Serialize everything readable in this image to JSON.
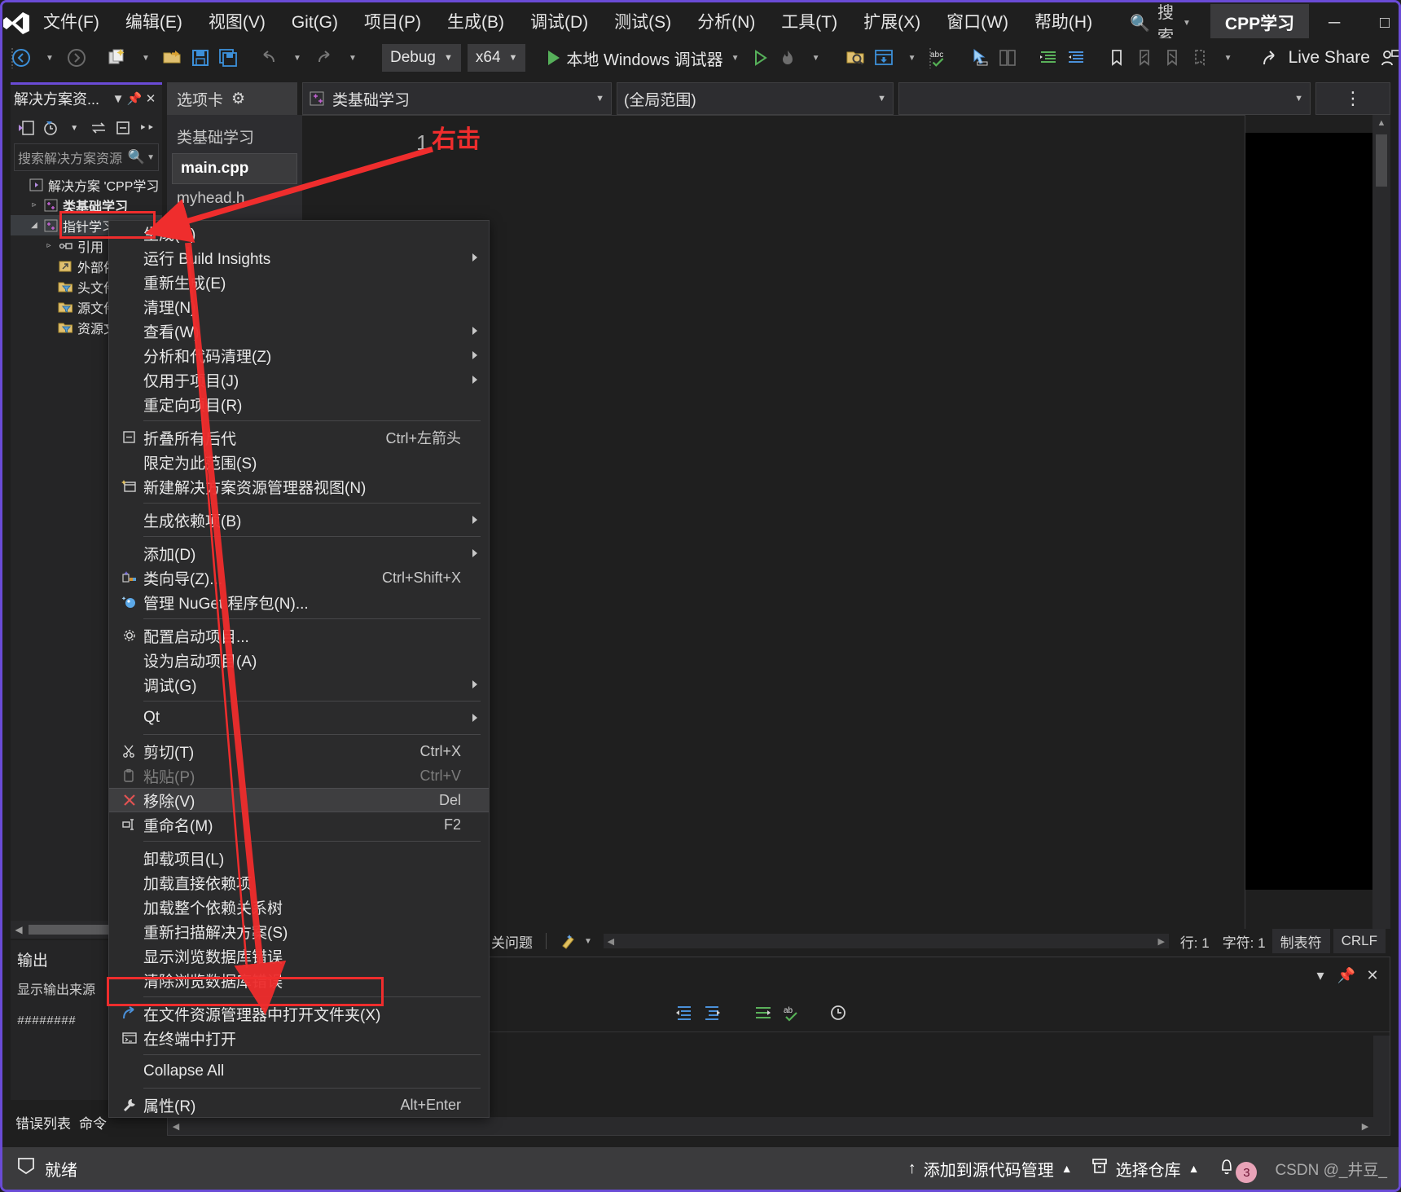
{
  "titlebar": {
    "logo_icon": "visual-studio-logo",
    "menus": [
      {
        "label": "文件(F)"
      },
      {
        "label": "编辑(E)"
      },
      {
        "label": "视图(V)"
      },
      {
        "label": "Git(G)"
      },
      {
        "label": "项目(P)"
      },
      {
        "label": "生成(B)"
      },
      {
        "label": "调试(D)"
      },
      {
        "label": "测试(S)"
      },
      {
        "label": "分析(N)"
      },
      {
        "label": "工具(T)"
      },
      {
        "label": "扩展(X)"
      },
      {
        "label": "窗口(W)"
      },
      {
        "label": "帮助(H)"
      }
    ],
    "search_label": "搜索",
    "search_icon": "search-icon",
    "project_chip": "CPP学习",
    "minimize": "─",
    "maximize": "□",
    "close": "✕"
  },
  "toolbar": {
    "nav_back_icon": "arrow-left-circle-icon",
    "nav_forward_icon": "arrow-right-circle-icon",
    "new_item_icon": "new-project-icon",
    "open_icon": "open-folder-icon",
    "save_icon": "save-icon",
    "save_all_icon": "save-all-icon",
    "undo_icon": "undo-icon",
    "redo_icon": "redo-icon",
    "config_value": "Debug",
    "platform_value": "x64",
    "run_label": "本地 Windows 调试器",
    "run_icon": "play-icon",
    "start_no_debug_icon": "play-outline-icon",
    "hot_reload_icon": "hot-reload-icon",
    "search_folder_icon": "folder-search-icon",
    "window_layout_icon": "window-layout-icon",
    "spellcheck_icon": "abc-check-icon",
    "pointer_icon": "pointer-select-icon",
    "compare_icon": "compare-icon",
    "indent_icon": "indent-icon",
    "outdent_icon": "outdent-icon",
    "bookmark_icon": "bookmark-icon",
    "bookmark_prev_icon": "bookmark-prev-icon",
    "bookmark_next_icon": "bookmark-next-icon",
    "bookmark_clear_icon": "bookmark-clear-icon",
    "live_share_label": "Live Share",
    "live_share_icon": "share-icon",
    "live_share_user_icon": "person-share-icon"
  },
  "solution_explorer": {
    "title": "解决方案资...",
    "dropdown_icon": "chevron-down-icon",
    "pin_icon": "pin-icon",
    "close_icon": "close-icon",
    "toolbar_icons": [
      "home-view-icon",
      "pending-changes-icon",
      "chevron-down-icon",
      "sync-icon",
      "collapse-all-icon",
      "overflow-icon"
    ],
    "search_placeholder": "搜索解决方案资源",
    "search_icon": "magnifier-icon",
    "search_caret_icon": "chevron-down-icon",
    "tree": [
      {
        "label": "解决方案 'CPP学习",
        "icon": "solution-icon",
        "indent": 0,
        "twisty": "",
        "bold": false,
        "selected": false
      },
      {
        "label": "类基础学习",
        "icon": "cpp-project-icon",
        "indent": 1,
        "twisty": "▹",
        "bold": true,
        "selected": false
      },
      {
        "label": "指针学习",
        "icon": "cpp-project-icon",
        "indent": 1,
        "twisty": "◢",
        "bold": false,
        "selected": true
      },
      {
        "label": "引用",
        "icon": "references-icon",
        "indent": 2,
        "twisty": "▹",
        "bold": false,
        "selected": false
      },
      {
        "label": "外部依赖项",
        "icon": "external-deps-icon",
        "indent": 2,
        "twisty": "",
        "bold": false,
        "selected": false
      },
      {
        "label": "头文件",
        "icon": "filter-folder-icon",
        "indent": 2,
        "twisty": "",
        "bold": false,
        "selected": false
      },
      {
        "label": "源文件",
        "icon": "filter-folder-icon",
        "indent": 2,
        "twisty": "",
        "bold": false,
        "selected": false
      },
      {
        "label": "资源文件",
        "icon": "filter-folder-icon",
        "indent": 2,
        "twisty": "",
        "bold": false,
        "selected": false
      }
    ]
  },
  "editor": {
    "tabstrip_label": "选项卡",
    "tabstrip_gear_icon": "gear-icon",
    "file_combo_value": "类基础学习",
    "file_combo_icon": "cpp-project-icon",
    "scope_combo_value": "(全局范围)",
    "third_combo_value": "",
    "split_icon": "split-view-icon",
    "tab_group_label": "类基础学习",
    "tabs": [
      {
        "label": "main.cpp",
        "active": true
      },
      {
        "label": "myhead.h",
        "active": false
      }
    ],
    "line_number": "1"
  },
  "editor_status": {
    "issues_label": "关问题",
    "brush_icon": "formatting-icon",
    "line_label": "行: 1",
    "col_label": "字符: 1",
    "tab_label": "制表符",
    "eol_label": "CRLF"
  },
  "output_panel": {
    "title": "输出",
    "source_label": "显示输出来源",
    "content": "########"
  },
  "bottom_tabs": {
    "items": [
      "错误列表",
      "命令"
    ]
  },
  "lower_panel": {
    "toolbar_icons": [
      "outdent-icon",
      "indent-icon",
      "wrap-icon",
      "abc-check-icon",
      "history-icon"
    ],
    "collapse_icon": "collapse-icon",
    "pin_icon": "pin-icon",
    "close_icon": "close-icon"
  },
  "statusbar": {
    "ready_label": "就绪",
    "ready_icon": "flag-icon",
    "source_control_label": "添加到源代码管理",
    "source_control_icon": "arrow-up-icon",
    "source_control_caret": "▲",
    "repo_label": "选择仓库",
    "repo_icon": "repo-icon",
    "repo_caret": "▲",
    "notification_icon": "bell-icon",
    "notification_count": "3",
    "watermark": "CSDN @_井豆_"
  },
  "context_menu": {
    "items": [
      {
        "label": "生成(U)",
        "icon": "",
        "shortcut": "",
        "submenu": false,
        "divider_after": false,
        "disabled": false,
        "highlight": false
      },
      {
        "label": "运行 Build Insights",
        "icon": "",
        "shortcut": "",
        "submenu": true,
        "divider_after": false,
        "disabled": false,
        "highlight": false
      },
      {
        "label": "重新生成(E)",
        "icon": "",
        "shortcut": "",
        "submenu": false,
        "divider_after": false,
        "disabled": false,
        "highlight": false
      },
      {
        "label": "清理(N)",
        "icon": "",
        "shortcut": "",
        "submenu": false,
        "divider_after": false,
        "disabled": false,
        "highlight": false
      },
      {
        "label": "查看(W)",
        "icon": "",
        "shortcut": "",
        "submenu": true,
        "divider_after": false,
        "disabled": false,
        "highlight": false
      },
      {
        "label": "分析和代码清理(Z)",
        "icon": "",
        "shortcut": "",
        "submenu": true,
        "divider_after": false,
        "disabled": false,
        "highlight": false
      },
      {
        "label": "仅用于项目(J)",
        "icon": "",
        "shortcut": "",
        "submenu": true,
        "divider_after": false,
        "disabled": false,
        "highlight": false
      },
      {
        "label": "重定向项目(R)",
        "icon": "",
        "shortcut": "",
        "submenu": false,
        "divider_after": true,
        "disabled": false,
        "highlight": false
      },
      {
        "label": "折叠所有后代",
        "icon": "collapse-box-icon",
        "shortcut": "Ctrl+左箭头",
        "submenu": false,
        "divider_after": false,
        "disabled": false,
        "highlight": false
      },
      {
        "label": "限定为此范围(S)",
        "icon": "",
        "shortcut": "",
        "submenu": false,
        "divider_after": false,
        "disabled": false,
        "highlight": false
      },
      {
        "label": "新建解决方案资源管理器视图(N)",
        "icon": "new-view-icon",
        "shortcut": "",
        "submenu": false,
        "divider_after": true,
        "disabled": false,
        "highlight": false
      },
      {
        "label": "生成依赖项(B)",
        "icon": "",
        "shortcut": "",
        "submenu": true,
        "divider_after": true,
        "disabled": false,
        "highlight": false
      },
      {
        "label": "添加(D)",
        "icon": "",
        "shortcut": "",
        "submenu": true,
        "divider_after": false,
        "disabled": false,
        "highlight": false
      },
      {
        "label": "类向导(Z)...",
        "icon": "class-wizard-icon",
        "shortcut": "Ctrl+Shift+X",
        "submenu": false,
        "divider_after": false,
        "disabled": false,
        "highlight": false
      },
      {
        "label": "管理 NuGet 程序包(N)...",
        "icon": "nuget-icon",
        "shortcut": "",
        "submenu": false,
        "divider_after": true,
        "disabled": false,
        "highlight": false
      },
      {
        "label": "配置启动项目...",
        "icon": "gear-icon",
        "shortcut": "",
        "submenu": false,
        "divider_after": false,
        "disabled": false,
        "highlight": false
      },
      {
        "label": "设为启动项目(A)",
        "icon": "",
        "shortcut": "",
        "submenu": false,
        "divider_after": false,
        "disabled": false,
        "highlight": false
      },
      {
        "label": "调试(G)",
        "icon": "",
        "shortcut": "",
        "submenu": true,
        "divider_after": true,
        "disabled": false,
        "highlight": false
      },
      {
        "label": "Qt",
        "icon": "",
        "shortcut": "",
        "submenu": true,
        "divider_after": true,
        "disabled": false,
        "highlight": false
      },
      {
        "label": "剪切(T)",
        "icon": "scissors-icon",
        "shortcut": "Ctrl+X",
        "submenu": false,
        "divider_after": false,
        "disabled": false,
        "highlight": false
      },
      {
        "label": "粘贴(P)",
        "icon": "clipboard-icon",
        "shortcut": "Ctrl+V",
        "submenu": false,
        "divider_after": false,
        "disabled": true,
        "highlight": false
      },
      {
        "label": "移除(V)",
        "icon": "x-red-icon",
        "shortcut": "Del",
        "submenu": false,
        "divider_after": false,
        "disabled": false,
        "highlight": true
      },
      {
        "label": "重命名(M)",
        "icon": "rename-icon",
        "shortcut": "F2",
        "submenu": false,
        "divider_after": true,
        "disabled": false,
        "highlight": false
      },
      {
        "label": "卸载项目(L)",
        "icon": "",
        "shortcut": "",
        "submenu": false,
        "divider_after": false,
        "disabled": false,
        "highlight": false
      },
      {
        "label": "加载直接依赖项",
        "icon": "",
        "shortcut": "",
        "submenu": false,
        "divider_after": false,
        "disabled": false,
        "highlight": false
      },
      {
        "label": "加载整个依赖关系树",
        "icon": "",
        "shortcut": "",
        "submenu": false,
        "divider_after": false,
        "disabled": false,
        "highlight": false
      },
      {
        "label": "重新扫描解决方案(S)",
        "icon": "",
        "shortcut": "",
        "submenu": false,
        "divider_after": false,
        "disabled": false,
        "highlight": false
      },
      {
        "label": "显示浏览数据库错误",
        "icon": "",
        "shortcut": "",
        "submenu": false,
        "divider_after": false,
        "disabled": false,
        "highlight": false
      },
      {
        "label": "清除浏览数据库错误",
        "icon": "",
        "shortcut": "",
        "submenu": false,
        "divider_after": true,
        "disabled": false,
        "highlight": false
      },
      {
        "label": "在文件资源管理器中打开文件夹(X)",
        "icon": "open-folder-arrow-icon",
        "shortcut": "",
        "submenu": false,
        "divider_after": false,
        "disabled": false,
        "highlight": false
      },
      {
        "label": "在终端中打开",
        "icon": "terminal-icon",
        "shortcut": "",
        "submenu": false,
        "divider_after": true,
        "disabled": false,
        "highlight": false
      },
      {
        "label": "Collapse All",
        "icon": "",
        "shortcut": "",
        "submenu": false,
        "divider_after": true,
        "disabled": false,
        "highlight": false
      },
      {
        "label": "属性(R)",
        "icon": "wrench-icon",
        "shortcut": "Alt+Enter",
        "submenu": false,
        "divider_after": false,
        "disabled": false,
        "highlight": false
      }
    ]
  },
  "annotations": {
    "right_click_label": "右击",
    "accent_color": "#ef2d2d"
  }
}
